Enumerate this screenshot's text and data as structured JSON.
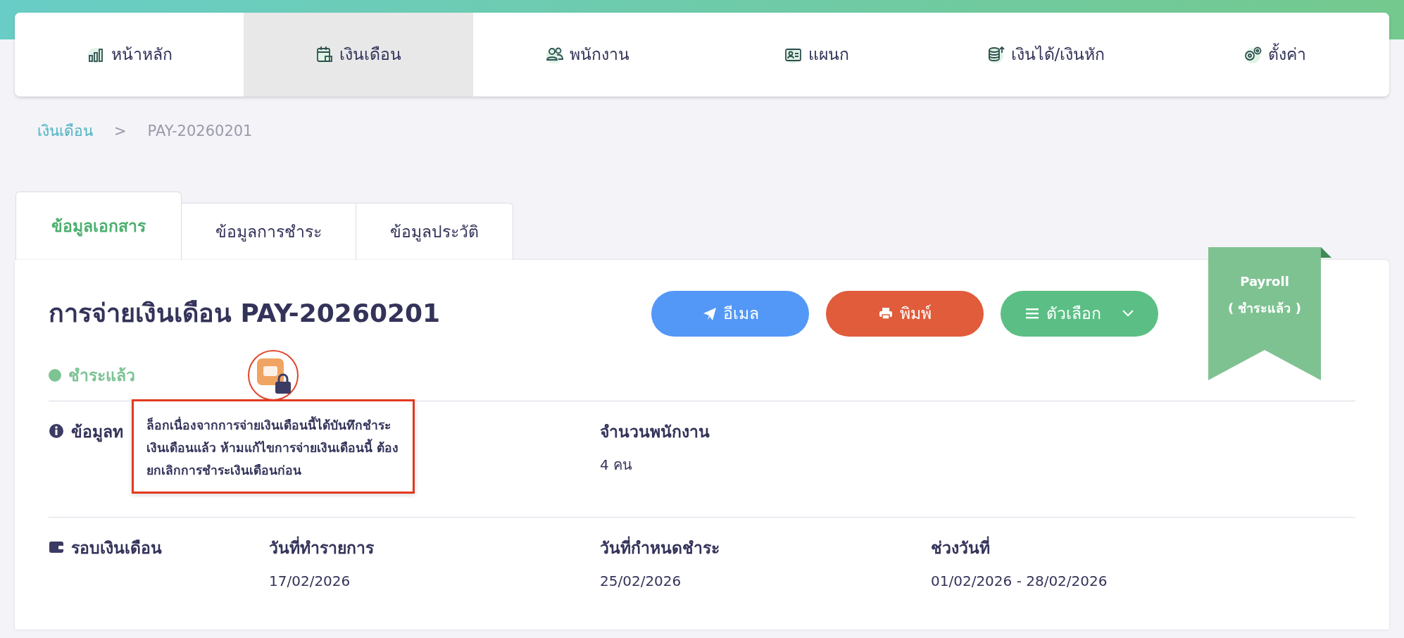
{
  "nav": {
    "items": [
      {
        "label": "หน้าหลัก",
        "selected": false
      },
      {
        "label": "เงินเดือน",
        "selected": true
      },
      {
        "label": "พนักงาน",
        "selected": false
      },
      {
        "label": "แผนก",
        "selected": false
      },
      {
        "label": "เงินได้/เงินหัก",
        "selected": false
      },
      {
        "label": "ตั้งค่า",
        "selected": false
      }
    ]
  },
  "breadcrumb": [
    {
      "label": "เงินเดือน",
      "kind": "link"
    },
    {
      "label": ">",
      "kind": "separator"
    },
    {
      "label": "PAY-20260201",
      "kind": "current"
    }
  ],
  "tabs": [
    {
      "label": "ข้อมูลเอกสาร",
      "selected": true
    },
    {
      "label": "ข้อมูลการชำระ",
      "selected": false
    },
    {
      "label": "ข้อมูลประวัติ",
      "selected": false
    }
  ],
  "document": {
    "title": "การจ่ายเงินเดือน PAY-20260201",
    "status": {
      "label": "ชำระแล้ว",
      "color": "#7dc394"
    },
    "lock_tooltip": "ล็อกเนื่องจากการจ่ายเงินเดือนนี้ได้บันทึกชำระเงินเดือนแล้ว ห้ามแก้ไขการจ่ายเงินเดือนนี้ ต้องยกเลิกการชำระเงินเดือนก่อน"
  },
  "actions": [
    {
      "label": "อีเมล",
      "kind": "email"
    },
    {
      "label": "พิมพ์",
      "kind": "print"
    },
    {
      "label": "ตัวเลือก",
      "kind": "options"
    }
  ],
  "ribbon": {
    "title": "Payroll",
    "subtitle": "( ชำระแล้ว )"
  },
  "sections": [
    {
      "heading": "ข้อมูลท",
      "fields": [
        {
          "label": "จำนวนพนักงาน",
          "value": "4 คน"
        }
      ]
    },
    {
      "heading": "รอบเงินเดือน",
      "fields": [
        {
          "label": "วันที่ทำรายการ",
          "value": "17/02/2026"
        },
        {
          "label": "วันที่กำหนดชำระ",
          "value": "25/02/2026"
        },
        {
          "label": "ช่วงวันที่",
          "value": "01/02/2026 - 28/02/2026"
        }
      ]
    }
  ]
}
